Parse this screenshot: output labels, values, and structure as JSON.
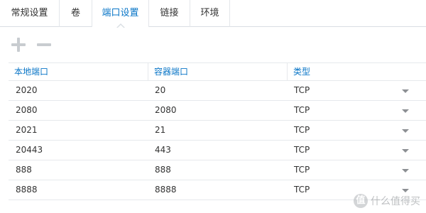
{
  "tabs": [
    {
      "label": "常规设置",
      "active": false
    },
    {
      "label": "卷",
      "active": false
    },
    {
      "label": "端口设置",
      "active": true
    },
    {
      "label": "链接",
      "active": false
    },
    {
      "label": "环境",
      "active": false
    }
  ],
  "toolbar": {
    "add_icon": "plus-icon",
    "remove_icon": "minus-icon"
  },
  "table": {
    "headers": [
      "本地端口",
      "容器端口",
      "类型"
    ],
    "rows": [
      {
        "local": "2020",
        "container": "20",
        "type": "TCP"
      },
      {
        "local": "2080",
        "container": "2080",
        "type": "TCP"
      },
      {
        "local": "2021",
        "container": "21",
        "type": "TCP"
      },
      {
        "local": "20443",
        "container": "443",
        "type": "TCP"
      },
      {
        "local": "888",
        "container": "888",
        "type": "TCP"
      },
      {
        "local": "8888",
        "container": "8888",
        "type": "TCP"
      }
    ]
  },
  "watermark": {
    "logo_char": "值",
    "text": "什么值得买"
  },
  "colors": {
    "accent": "#0a76c7",
    "border": "#e6e9ec",
    "icon_gray": "#c8ccd0"
  }
}
